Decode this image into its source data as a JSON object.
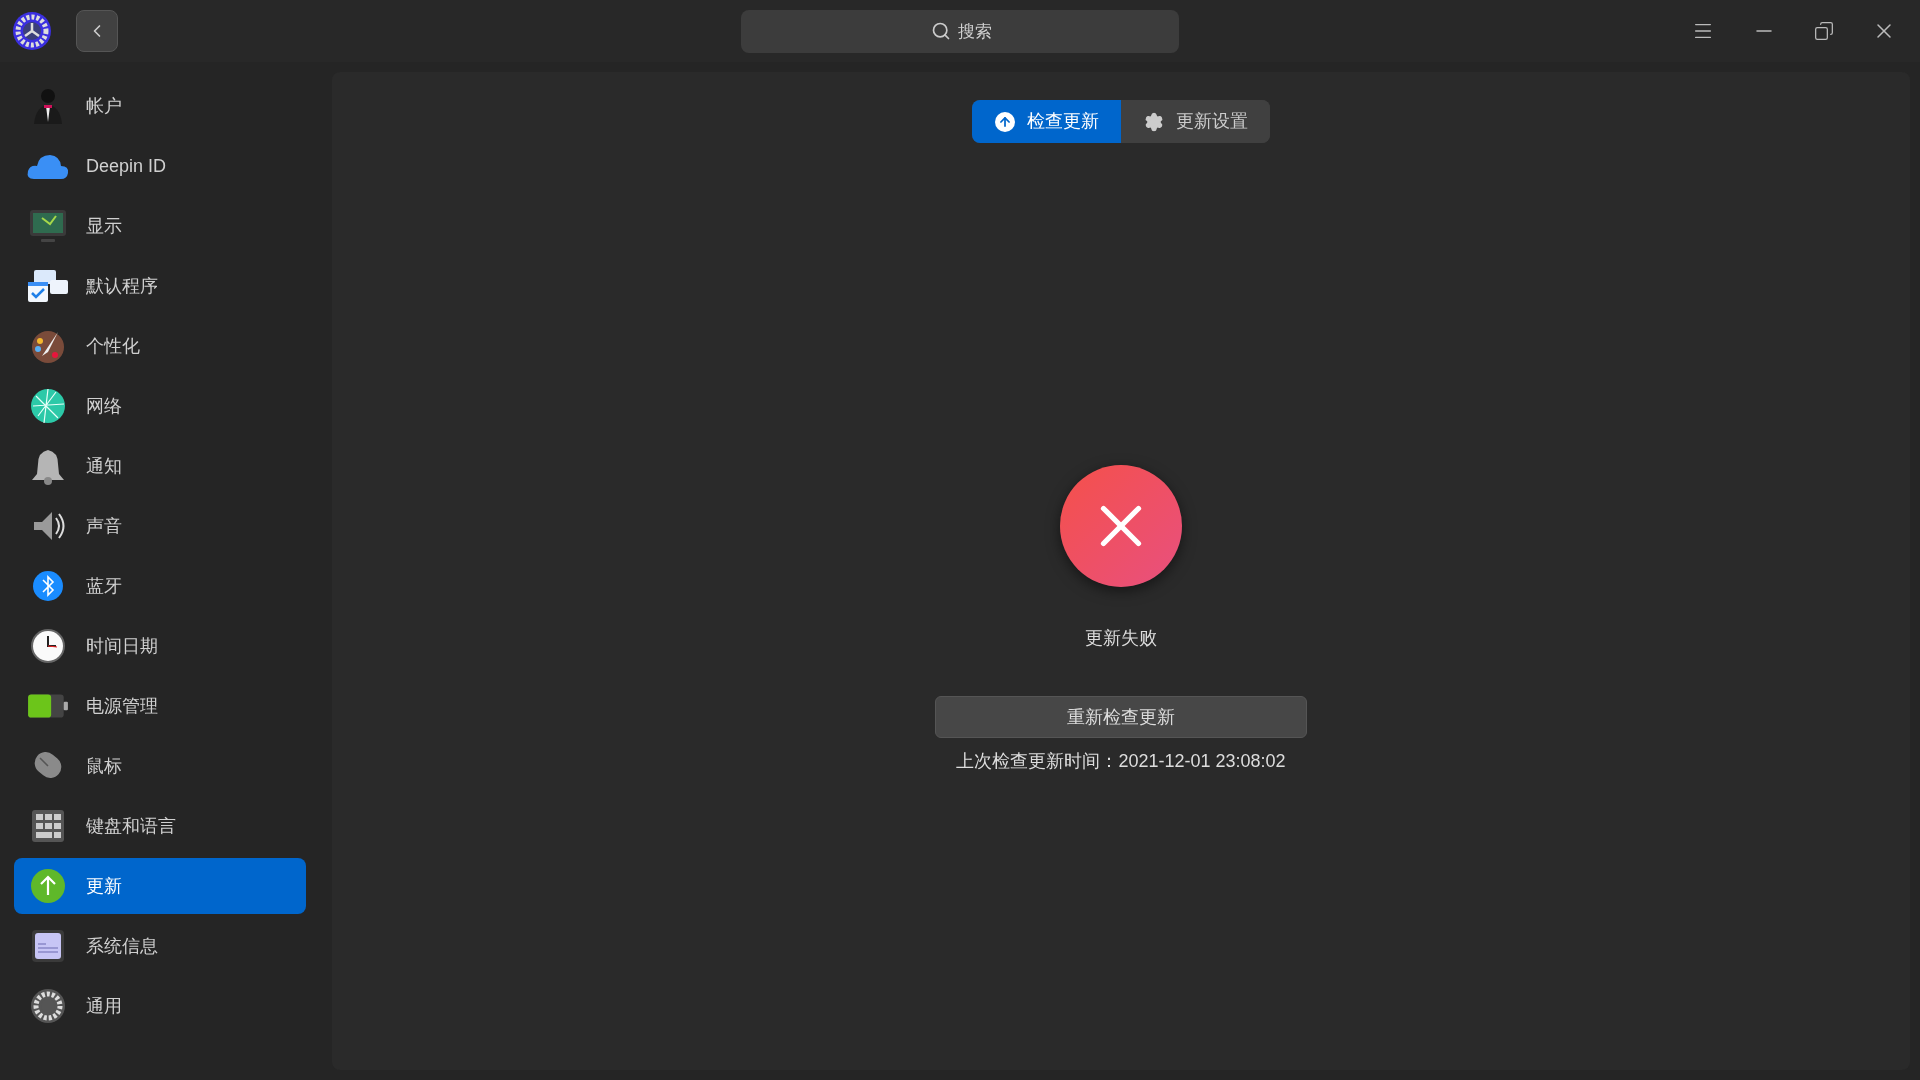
{
  "titlebar": {
    "search": {
      "placeholder": "搜索"
    }
  },
  "sidebar": {
    "items": [
      {
        "label": "帐户",
        "selected": false
      },
      {
        "label": "Deepin ID",
        "selected": false
      },
      {
        "label": "显示",
        "selected": false
      },
      {
        "label": "默认程序",
        "selected": false
      },
      {
        "label": "个性化",
        "selected": false
      },
      {
        "label": "网络",
        "selected": false
      },
      {
        "label": "通知",
        "selected": false
      },
      {
        "label": "声音",
        "selected": false
      },
      {
        "label": "蓝牙",
        "selected": false
      },
      {
        "label": "时间日期",
        "selected": false
      },
      {
        "label": "电源管理",
        "selected": false
      },
      {
        "label": "鼠标",
        "selected": false
      },
      {
        "label": "键盘和语言",
        "selected": false
      },
      {
        "label": "更新",
        "selected": true
      },
      {
        "label": "系统信息",
        "selected": false
      },
      {
        "label": "通用",
        "selected": false
      }
    ]
  },
  "tabs": [
    {
      "label": "检查更新",
      "selected": true
    },
    {
      "label": "更新设置",
      "selected": false
    }
  ],
  "status": {
    "title": "更新失败",
    "button": "重新检查更新",
    "last_check": "上次检查更新时间：2021-12-01 23:08:02"
  }
}
